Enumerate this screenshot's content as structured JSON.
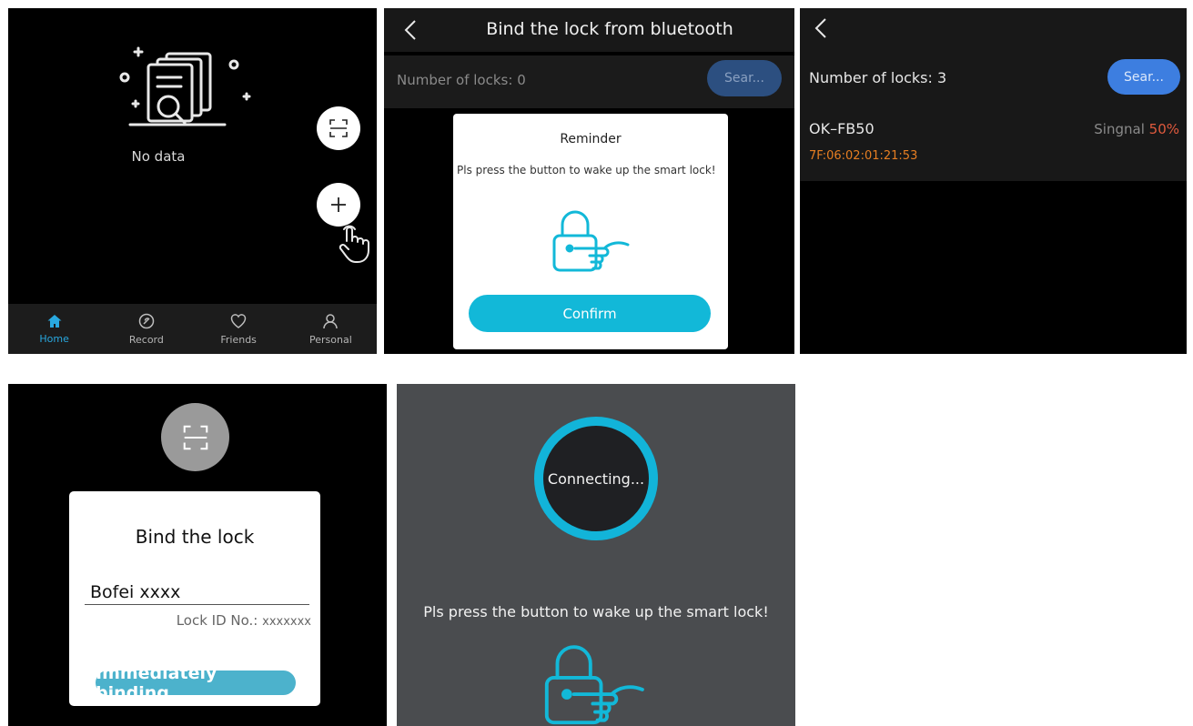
{
  "home": {
    "empty_text": "No data",
    "tabs": [
      {
        "label": "Home",
        "icon": "home-icon",
        "active": true
      },
      {
        "label": "Record",
        "icon": "record-icon",
        "active": false
      },
      {
        "label": "Friends",
        "icon": "heart-icon",
        "active": false
      },
      {
        "label": "Personal",
        "icon": "person-icon",
        "active": false
      }
    ],
    "accent": "#29a8df"
  },
  "bluetooth_bind": {
    "title": "Bind the lock from bluetooth",
    "count_label": "Number of locks:",
    "count_value": "0",
    "search_label": "Sear...",
    "dialog": {
      "title": "Reminder",
      "message": "Pls press the button to wake up the smart lock!",
      "confirm_label": "Confirm"
    }
  },
  "search_results": {
    "count_label": "Number of locks:",
    "count_value": "3",
    "search_label": "Sear...",
    "lock": {
      "name": "OK–FB50",
      "signal_label": "Singnal",
      "signal_value": "50%",
      "mac": "7F:06:02:01:21:53"
    }
  },
  "bind_card": {
    "title": "Bind the lock",
    "lock_name": "Bofei xxxx",
    "lock_id_label": "Lock ID No.:",
    "lock_id_value": "xxxxxxx",
    "bind_button": "Immediately binding"
  },
  "connecting": {
    "status": "Connecting...",
    "message": "Pls press the button to wake up the smart lock!"
  },
  "colors": {
    "cyan": "#12b8d8",
    "blue_button": "#3d7ee0",
    "signal": "#e05a3d",
    "mac": "#e67e22"
  }
}
